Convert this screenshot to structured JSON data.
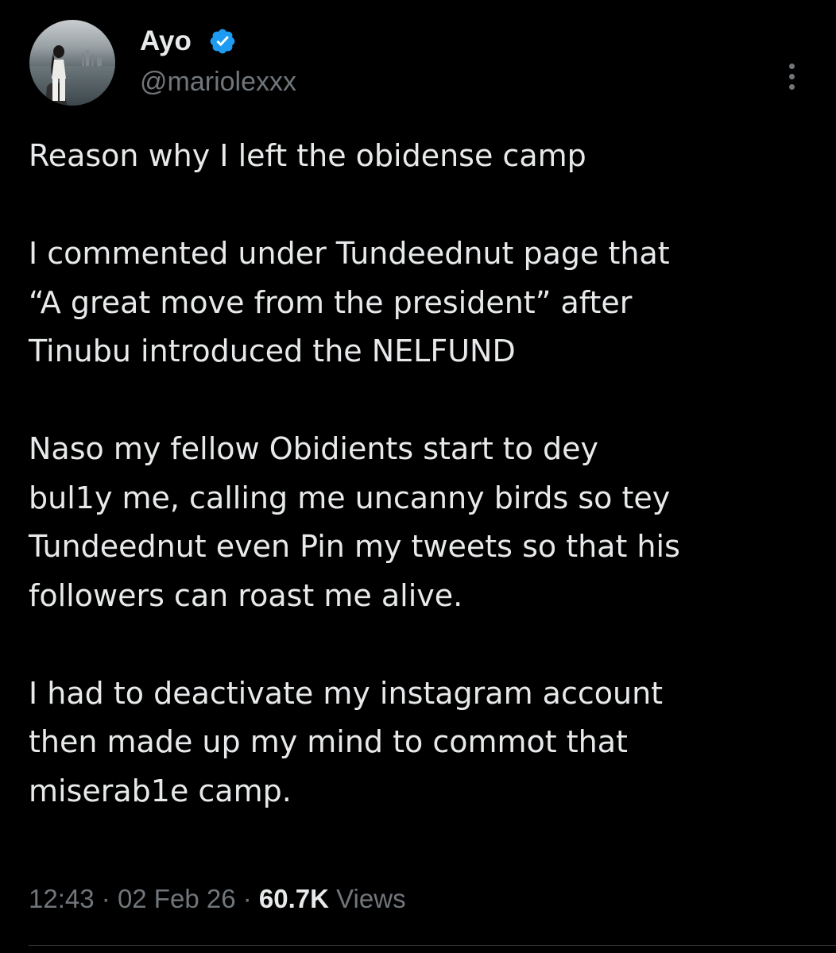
{
  "author": {
    "display_name": "Ayo",
    "handle": "@mariolexxx",
    "verified": true,
    "avatar_icon": "profile-photo-beach",
    "verified_icon": "verified-badge-icon",
    "verified_color": "#1d9bf0"
  },
  "menu": {
    "icon": "more-vertical-icon"
  },
  "tweet": {
    "paragraphs": [
      [
        "Reason why I left the obidense camp"
      ],
      [
        "I commented under Tundeednut page that",
        "“A great move from the president” after",
        "Tinubu introduced the NELFUND"
      ],
      [
        "Naso my fellow Obidients start to dey",
        "bul1y me, calling me uncanny birds so tey",
        "Tundeednut even Pin my tweets so that his",
        "followers can roast me alive."
      ],
      [
        "I had to deactivate my instagram account",
        "then made up my mind to commot that",
        "miserab1e camp."
      ]
    ]
  },
  "meta": {
    "time": "12:43",
    "separator": "·",
    "date": "02 Feb 26",
    "views_count": "60.7K",
    "views_label": "Views"
  },
  "colors": {
    "background": "#000000",
    "text_primary": "#e7e9ea",
    "text_secondary": "#71767b",
    "divider": "#2f3336"
  }
}
